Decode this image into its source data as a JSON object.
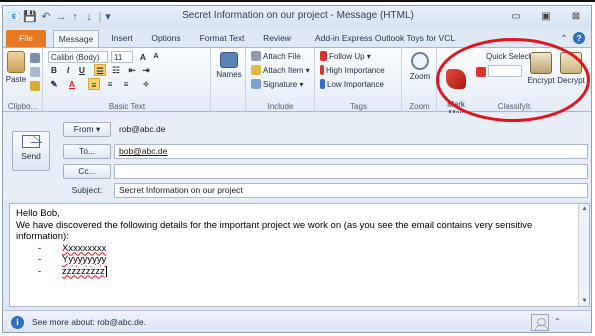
{
  "colors": {
    "file_tab": "#e9781e",
    "accent": "#2f6fc0",
    "annotation": "#e0141e"
  },
  "window": {
    "title": "Secret Information on our project - Message (HTML)",
    "controls": [
      "▭",
      "▣",
      "⊠"
    ],
    "quick_access": [
      "📧",
      "💾",
      "↶",
      "→",
      "↑",
      "↓",
      "|",
      "▾"
    ]
  },
  "tabs": [
    "File",
    "Message",
    "Insert",
    "Options",
    "Format Text",
    "Review",
    "Add-in Express Outlook Toys for VCL"
  ],
  "ribbon_right_icons": [
    "⌃",
    "?"
  ],
  "ribbon": {
    "clipboard": {
      "paste": "Paste",
      "label": "Clipbo..."
    },
    "basic_text": {
      "font": "Calibri (Body)",
      "size": "11",
      "label": "Basic Text"
    },
    "names": {
      "label": "Names"
    },
    "include": {
      "attach_file": "Attach File",
      "attach_item": "Attach Item ▾",
      "signature": "Signature ▾",
      "label": "Include"
    },
    "tags": {
      "follow_up": "Follow Up ▾",
      "high": "High Importance",
      "low": "Low Importance",
      "label": "Tags"
    },
    "zoom": {
      "zoom": "Zoom",
      "label": "Zoom"
    },
    "classifyit": {
      "mark_mail": "Mark\nMail",
      "quick_select": "Quick Select",
      "encrypt": "Encrypt",
      "decrypt": "Decrypt",
      "label": "ClassifyIt"
    }
  },
  "compose": {
    "send": "Send",
    "from": "From ▾",
    "from_value": "rob@abc.de",
    "to": "To...",
    "to_value": "bob@abc.de",
    "cc": "Cc...",
    "cc_value": "",
    "subject_label": "Subject:",
    "subject_value": "Secret Information on our project"
  },
  "message": {
    "greeting": "Hello Bob,",
    "line1": "We have discovered the following details for the important project we work on (as you see the email contains very sensitive",
    "line2": "information):",
    "bullets": [
      "Xxxxxxxxx",
      "Yyyyyyyyy",
      "zzzzzzzzz"
    ],
    "dash": "-"
  },
  "people_pane": {
    "text": "See more about: rob@abc.de."
  }
}
